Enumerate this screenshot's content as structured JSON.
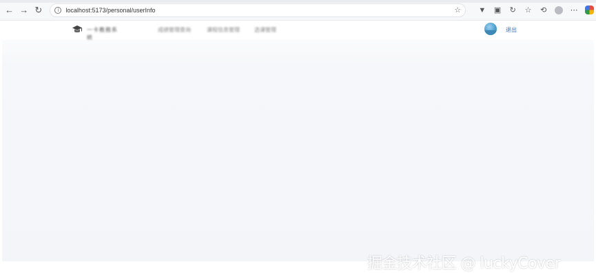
{
  "browser": {
    "back_icon": "←",
    "forward_icon": "→",
    "reload_icon": "↻",
    "info_icon": "i",
    "url": "localhost:5173/personal/userInfo",
    "bookmark_icon": "☆",
    "ext_icons": [
      "▼",
      "▣",
      "↻",
      "☆",
      "⟲"
    ],
    "more_icon": "⋯"
  },
  "site": {
    "logo_text": "一卡教務系統",
    "menu": [
      "成绩管理查询",
      "课程信息管理",
      "选课管理"
    ],
    "logout_label": "退出"
  },
  "watermark": "掘金技术社区 @ luckyCover"
}
